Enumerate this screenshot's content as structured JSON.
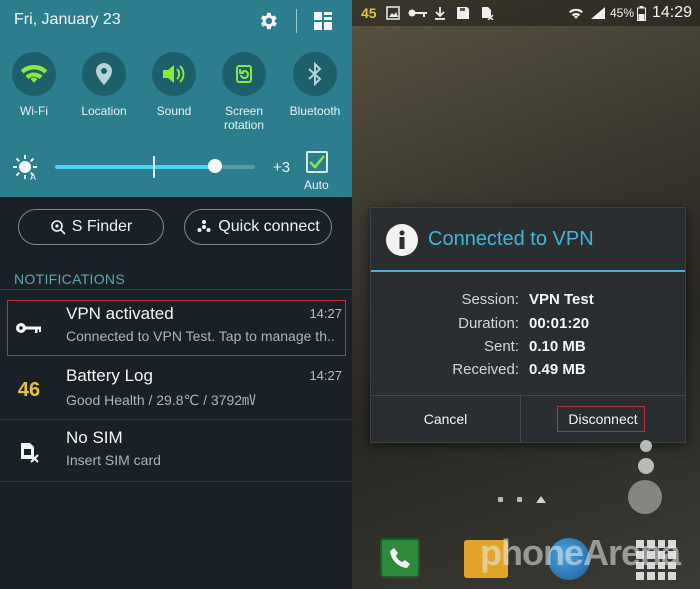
{
  "quick_settings": {
    "date": "Fri, January 23",
    "tiles": [
      {
        "label": "Wi-Fi",
        "icon": "wifi-icon"
      },
      {
        "label": "Location",
        "icon": "location-icon"
      },
      {
        "label": "Sound",
        "icon": "sound-icon"
      },
      {
        "label": "Screen rotation",
        "icon": "screen-rotation-icon"
      },
      {
        "label": "Bluetooth",
        "icon": "bluetooth-icon"
      }
    ],
    "brightness": {
      "level": 0.8,
      "value_label": "+3",
      "auto_label": "Auto",
      "auto_checked": true
    },
    "buttons": {
      "s_finder": "S Finder",
      "quick_connect": "Quick connect"
    }
  },
  "notifications": {
    "header": "NOTIFICATIONS",
    "items": [
      {
        "title": "VPN activated",
        "subtitle": "Connected to VPN Test. Tap to manage th..",
        "time": "14:27",
        "icon": "key-icon"
      },
      {
        "title": "Battery Log",
        "subtitle": "Good Health / 29.8℃ / 3792㎷",
        "time": "14:27",
        "icon_text": "46"
      },
      {
        "title": "No SIM",
        "subtitle": "Insert SIM card",
        "icon": "no-sim-icon"
      }
    ]
  },
  "status_bar": {
    "badge": "45",
    "battery": "45%",
    "clock": "14:29"
  },
  "dialog": {
    "title": "Connected to VPN",
    "rows": [
      {
        "label": "Session:",
        "value": "VPN Test"
      },
      {
        "label": "Duration:",
        "value": "00:01:20"
      },
      {
        "label": "Sent:",
        "value": "0.10 MB"
      },
      {
        "label": "Received:",
        "value": "0.49 MB"
      }
    ],
    "cancel_label": "Cancel",
    "disconnect_label": "Disconnect"
  },
  "watermark": "phoneArena",
  "colors": {
    "accent": "#3fb5dd",
    "teal": "#2c7d8d",
    "highlight_red": "#c0303a",
    "battery_yellow": "#e9c43a"
  }
}
